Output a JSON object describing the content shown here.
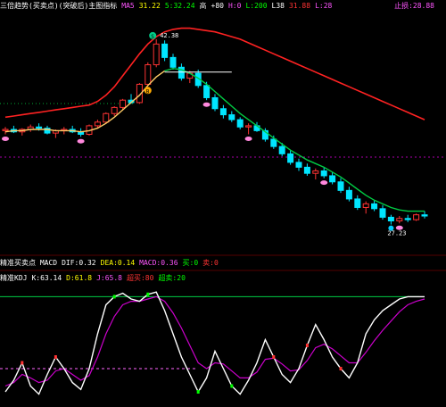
{
  "top_bar": {
    "title": "三倍趋势(买卖点)(突破后)主图指标",
    "items": [
      {
        "text": "MA5",
        "color": "#ff55ff"
      },
      {
        "text": "31.22",
        "color": "#ffff00"
      },
      {
        "text": "5:32.24",
        "color": "#00ff00"
      },
      {
        "text": "高",
        "color": "#dddddd"
      },
      {
        "text": "+80",
        "color": "#ffffff"
      },
      {
        "text": "H:0",
        "color": "#ff55ff"
      },
      {
        "text": "L:200",
        "color": "#00ff00"
      },
      {
        "text": "L38",
        "color": "#ffffff"
      },
      {
        "text": "31.88",
        "color": "#ff3333"
      },
      {
        "text": "L:28",
        "color": "#ff55ff"
      }
    ],
    "right_label": {
      "text": "止损:28.88",
      "color": "#ff55ff"
    }
  },
  "mid_bar": {
    "title": "精准买卖点 MACD",
    "items": [
      {
        "text": "DIF:0.32",
        "color": "#ffffff"
      },
      {
        "text": "DEA:0.14",
        "color": "#ffff00"
      },
      {
        "text": "MACD:0.36",
        "color": "#ff55ff"
      },
      {
        "text": "买:0",
        "color": "#00ff00"
      },
      {
        "text": "卖:0",
        "color": "#ff3333"
      }
    ]
  },
  "low_bar": {
    "title": "精准KDJ",
    "items": [
      {
        "text": "K:63.14",
        "color": "#ffffff"
      },
      {
        "text": "D:61.8",
        "color": "#ffff00"
      },
      {
        "text": "J:65.8",
        "color": "#ff55ff"
      },
      {
        "text": "超买:80",
        "color": "#ff3333"
      },
      {
        "text": "超卖:20",
        "color": "#00ff00"
      }
    ]
  },
  "annotations": {
    "peak_value": "42.38",
    "low_value": "27.23",
    "sell_marker": "S",
    "buy_marker": "B"
  },
  "colors": {
    "up": "#ff3333",
    "down": "#00e5ff",
    "trend_line": "#ff2222",
    "support_line": "#00cc44",
    "baseline": "#aa00aa",
    "k_line": "#ffffff",
    "d_line": "#cc00cc",
    "top_rule": "#00cc44",
    "level_line": "#ff66ff"
  },
  "chart_data": {
    "type": "candlestick",
    "candles": [
      [
        34.9,
        35.2,
        34.6,
        35.0
      ],
      [
        35.0,
        35.3,
        34.7,
        34.8
      ],
      [
        34.8,
        35.1,
        34.5,
        35.0
      ],
      [
        35.0,
        35.4,
        34.8,
        35.2
      ],
      [
        35.2,
        35.5,
        34.9,
        35.1
      ],
      [
        35.1,
        35.3,
        34.6,
        34.7
      ],
      [
        34.7,
        35.0,
        34.3,
        34.9
      ],
      [
        34.9,
        35.2,
        34.6,
        35.0
      ],
      [
        35.0,
        35.3,
        34.7,
        34.8
      ],
      [
        34.8,
        35.1,
        34.4,
        34.6
      ],
      [
        34.6,
        35.4,
        34.5,
        35.3
      ],
      [
        35.3,
        35.8,
        35.1,
        35.6
      ],
      [
        35.6,
        36.4,
        35.5,
        36.3
      ],
      [
        36.3,
        36.9,
        36.1,
        36.8
      ],
      [
        36.8,
        37.5,
        36.6,
        37.4
      ],
      [
        37.4,
        37.9,
        37.1,
        37.2
      ],
      [
        37.2,
        38.8,
        37.1,
        38.7
      ],
      [
        38.7,
        40.5,
        38.6,
        40.3
      ],
      [
        40.3,
        42.4,
        40.1,
        42.0
      ],
      [
        42.0,
        42.3,
        40.6,
        40.9
      ],
      [
        40.9,
        41.2,
        39.9,
        40.1
      ],
      [
        40.1,
        40.4,
        39.0,
        39.2
      ],
      [
        39.2,
        39.8,
        38.8,
        39.6
      ],
      [
        39.6,
        39.9,
        38.4,
        38.6
      ],
      [
        38.6,
        38.9,
        37.4,
        37.6
      ],
      [
        37.6,
        37.9,
        36.5,
        36.7
      ],
      [
        36.7,
        37.0,
        35.9,
        36.2
      ],
      [
        36.2,
        36.5,
        35.6,
        35.8
      ],
      [
        35.8,
        36.0,
        35.0,
        35.2
      ],
      [
        35.2,
        35.5,
        34.6,
        35.3
      ],
      [
        35.3,
        35.6,
        34.8,
        34.9
      ],
      [
        34.9,
        35.1,
        34.0,
        34.2
      ],
      [
        34.2,
        34.5,
        33.4,
        33.6
      ],
      [
        33.6,
        33.9,
        32.8,
        33.0
      ],
      [
        33.0,
        33.3,
        32.1,
        32.3
      ],
      [
        32.3,
        32.6,
        31.6,
        31.9
      ],
      [
        31.9,
        32.2,
        31.2,
        31.4
      ],
      [
        31.4,
        31.8,
        30.9,
        31.6
      ],
      [
        31.6,
        31.9,
        31.0,
        31.2
      ],
      [
        31.2,
        31.5,
        30.5,
        30.7
      ],
      [
        30.7,
        31.0,
        29.8,
        30.0
      ],
      [
        30.0,
        30.3,
        29.1,
        29.3
      ],
      [
        29.3,
        29.6,
        28.4,
        28.6
      ],
      [
        28.6,
        29.1,
        28.1,
        28.9
      ],
      [
        28.9,
        29.2,
        28.3,
        28.5
      ],
      [
        28.5,
        28.8,
        27.6,
        27.8
      ],
      [
        27.8,
        28.0,
        27.2,
        27.5
      ],
      [
        27.5,
        27.9,
        27.3,
        27.7
      ],
      [
        27.7,
        28.0,
        27.4,
        27.6
      ],
      [
        27.6,
        28.1,
        27.5,
        28.0
      ],
      [
        28.0,
        28.3,
        27.7,
        27.9
      ]
    ],
    "red_curve": [
      36.0,
      36.1,
      36.2,
      36.3,
      36.4,
      36.5,
      36.6,
      36.7,
      36.8,
      36.9,
      37.0,
      37.3,
      37.8,
      38.5,
      39.4,
      40.3,
      41.2,
      42.0,
      42.6,
      43.0,
      43.2,
      43.3,
      43.3,
      43.2,
      43.1,
      43.0,
      42.8,
      42.6,
      42.4,
      42.1,
      41.8,
      41.5,
      41.2,
      40.9,
      40.6,
      40.3,
      40.0,
      39.7,
      39.4,
      39.1,
      38.8,
      38.5,
      38.2,
      37.9,
      37.6,
      37.3,
      37.0,
      36.7,
      36.4,
      36.1,
      35.8
    ],
    "support_curve": [
      34.8,
      34.9,
      34.9,
      35.0,
      35.0,
      35.0,
      34.9,
      34.9,
      34.9,
      34.8,
      34.9,
      35.1,
      35.5,
      36.0,
      36.6,
      37.2,
      37.8,
      38.6,
      39.3,
      39.8,
      40.0,
      39.9,
      39.6,
      39.2,
      38.7,
      38.1,
      37.5,
      36.9,
      36.3,
      35.8,
      35.3,
      34.8,
      34.3,
      33.8,
      33.3,
      32.9,
      32.5,
      32.2,
      31.9,
      31.5,
      31.1,
      30.6,
      30.1,
      29.6,
      29.2,
      28.9,
      28.6,
      28.4,
      28.3,
      28.3,
      28.3
    ],
    "kdj_k": [
      10,
      20,
      35,
      15,
      8,
      25,
      40,
      30,
      18,
      12,
      30,
      60,
      85,
      92,
      95,
      90,
      88,
      94,
      96,
      80,
      60,
      40,
      25,
      10,
      22,
      45,
      30,
      15,
      8,
      20,
      35,
      55,
      40,
      25,
      18,
      30,
      50,
      68,
      55,
      40,
      30,
      22,
      35,
      60,
      72,
      80,
      85,
      90,
      92,
      92,
      92
    ],
    "kdj_d": [
      15,
      18,
      25,
      22,
      18,
      20,
      28,
      30,
      25,
      20,
      24,
      40,
      60,
      75,
      85,
      88,
      88,
      90,
      92,
      88,
      78,
      65,
      50,
      35,
      30,
      35,
      34,
      28,
      22,
      22,
      27,
      38,
      39,
      34,
      28,
      29,
      37,
      48,
      51,
      47,
      41,
      35,
      35,
      44,
      54,
      63,
      71,
      79,
      85,
      88,
      90
    ],
    "ylim": [
      26,
      44
    ]
  }
}
